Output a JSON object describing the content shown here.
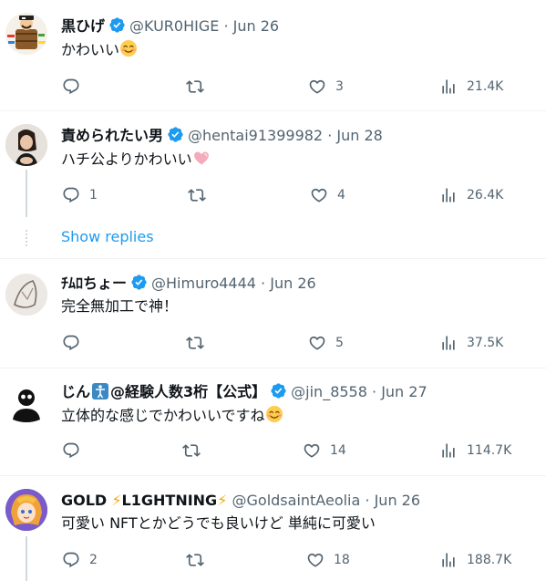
{
  "tweets": [
    {
      "name": "黒ひげ",
      "handle": "@KUR0HIGE",
      "date": "Jun 26",
      "text": "かわいい",
      "emoji": "smiling-face-with-smiling-eyes",
      "replies": "",
      "retweets": "",
      "likes": "3",
      "views": "21.4K"
    },
    {
      "name": "責められたい男",
      "handle": "@hentai91399982",
      "date": "Jun 28",
      "text": "ハチ公よりかわいい",
      "emoji": "pink-heart",
      "replies": "1",
      "retweets": "",
      "likes": "4",
      "views": "26.4K"
    },
    {
      "name": "ﾁﾑﾛちょー",
      "handle": "@Himuro4444",
      "date": "Jun 26",
      "text": "完全無加工で神！",
      "emoji": "",
      "replies": "",
      "retweets": "",
      "likes": "5",
      "views": "37.5K"
    },
    {
      "name": "じん",
      "name_suffix": "@経験人数3桁【公式】",
      "handle": "@jin_8558",
      "date": "Jun 27",
      "text": "立体的な感じでかわいいですね",
      "emoji": "smiling-face-with-smiling-eyes",
      "replies": "",
      "retweets": "",
      "likes": "14",
      "views": "114.7K"
    },
    {
      "name": "GOLD",
      "name_mid": "L1GHTNING",
      "handle": "@GoldsaintAeolia",
      "date": "Jun 26",
      "text": "可愛い NFTとかどうでも良いけど 単純に可愛い",
      "emoji": "",
      "replies": "2",
      "retweets": "",
      "likes": "18",
      "views": "188.7K"
    }
  ],
  "show_replies": "Show replies",
  "separator": "·",
  "colors": {
    "text": "#0f1419",
    "secondary": "#536471",
    "accent": "#1d9bf0",
    "divider": "#eff3f4",
    "thread": "#cfd9de"
  }
}
